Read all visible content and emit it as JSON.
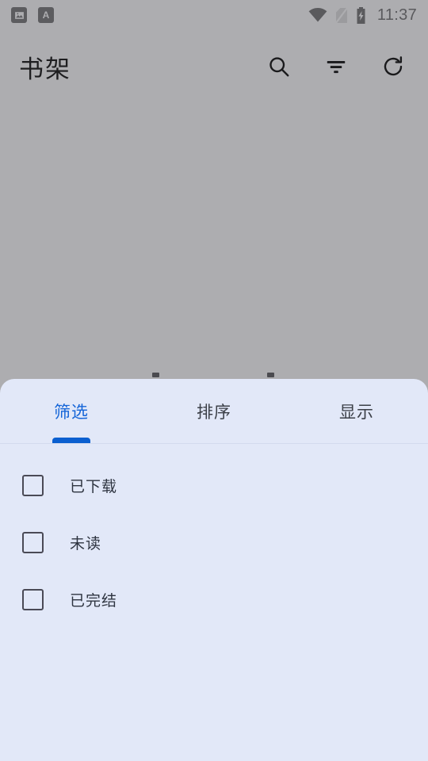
{
  "status_bar": {
    "notifications": [
      {
        "icon": "image-notification-icon",
        "label": ""
      },
      {
        "icon": "translate-notification-icon",
        "label": "A"
      }
    ],
    "wifi_icon": "wifi-icon",
    "sim_icon": "no-sim-icon",
    "battery_icon": "battery-charging-icon",
    "time": "11:37"
  },
  "app_bar": {
    "title": "书架",
    "actions": [
      {
        "name": "search-button",
        "icon": "search-icon"
      },
      {
        "name": "filter-button",
        "icon": "filter-icon"
      },
      {
        "name": "refresh-button",
        "icon": "refresh-icon"
      }
    ]
  },
  "bottom_sheet": {
    "tabs": [
      {
        "label": "筛选",
        "active": true
      },
      {
        "label": "排序",
        "active": false
      },
      {
        "label": "显示",
        "active": false
      }
    ],
    "filters": [
      {
        "label": "已下载",
        "checked": false
      },
      {
        "label": "未读",
        "checked": false
      },
      {
        "label": "已完结",
        "checked": false
      }
    ]
  },
  "colors": {
    "scrim": "#ADADB0",
    "sheet_background": "#E2E8F8",
    "accent": "#0B5FD0",
    "active_tab_text": "#1565D8",
    "inactive_tab_text": "#3B3F47",
    "label_text": "#2E3440",
    "checkbox_border": "#4A4A56"
  }
}
